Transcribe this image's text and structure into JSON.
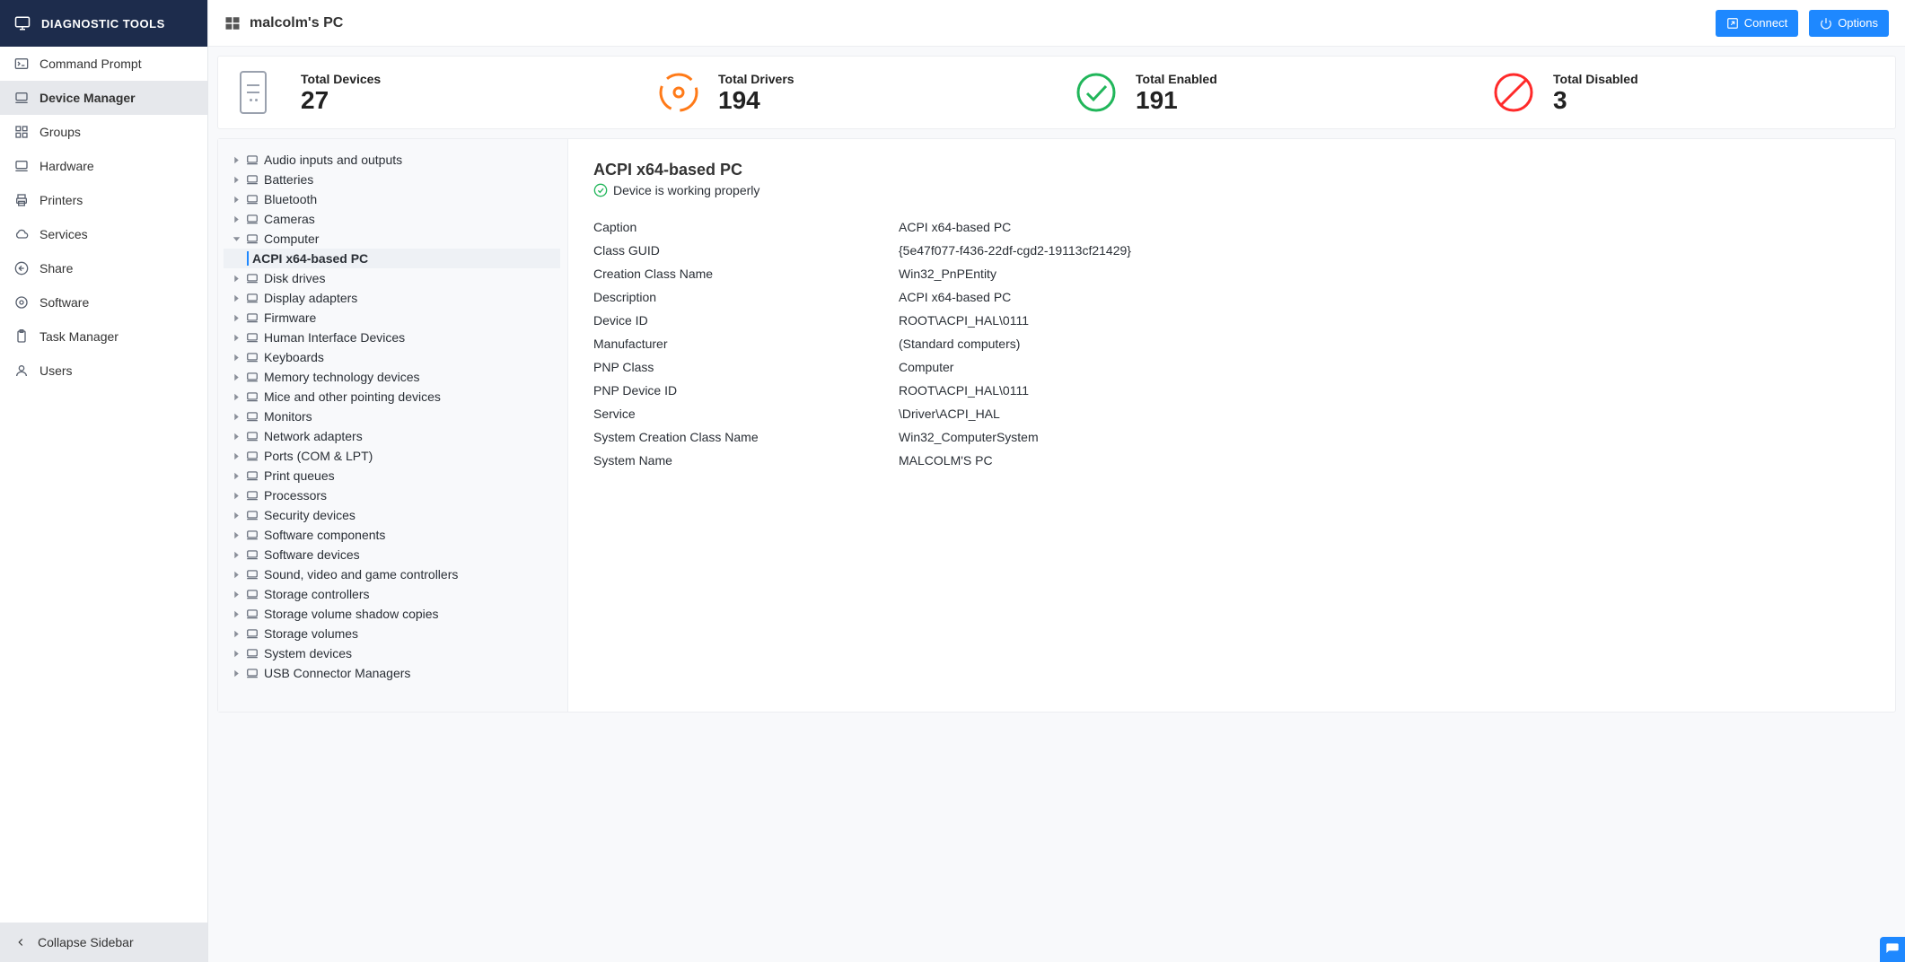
{
  "sidebar": {
    "header": "DIAGNOSTIC TOOLS",
    "items": [
      {
        "label": "Command Prompt",
        "icon": "terminal-icon"
      },
      {
        "label": "Device Manager",
        "icon": "laptop-icon"
      },
      {
        "label": "Groups",
        "icon": "grid-icon"
      },
      {
        "label": "Hardware",
        "icon": "laptop-icon"
      },
      {
        "label": "Printers",
        "icon": "printer-icon"
      },
      {
        "label": "Services",
        "icon": "cloud-icon"
      },
      {
        "label": "Share",
        "icon": "share-icon"
      },
      {
        "label": "Software",
        "icon": "target-icon"
      },
      {
        "label": "Task Manager",
        "icon": "clipboard-icon"
      },
      {
        "label": "Users",
        "icon": "user-icon"
      }
    ],
    "active_index": 1,
    "footer": "Collapse Sidebar"
  },
  "topbar": {
    "title": "malcolm's PC",
    "connect": "Connect",
    "options": "Options"
  },
  "summary": {
    "devices": {
      "label": "Total Devices",
      "value": "27"
    },
    "drivers": {
      "label": "Total Drivers",
      "value": "194"
    },
    "enabled": {
      "label": "Total Enabled",
      "value": "191"
    },
    "disabled": {
      "label": "Total Disabled",
      "value": "3"
    }
  },
  "tree": {
    "categories": [
      {
        "label": "Audio inputs and outputs"
      },
      {
        "label": "Batteries"
      },
      {
        "label": "Bluetooth"
      },
      {
        "label": "Cameras"
      },
      {
        "label": "Computer",
        "expanded": true,
        "children": [
          {
            "label": "ACPI x64-based PC",
            "selected": true
          }
        ]
      },
      {
        "label": "Disk drives"
      },
      {
        "label": "Display adapters"
      },
      {
        "label": "Firmware"
      },
      {
        "label": "Human Interface Devices"
      },
      {
        "label": "Keyboards"
      },
      {
        "label": "Memory technology devices"
      },
      {
        "label": "Mice and other pointing devices"
      },
      {
        "label": "Monitors"
      },
      {
        "label": "Network adapters"
      },
      {
        "label": "Ports (COM & LPT)"
      },
      {
        "label": "Print queues"
      },
      {
        "label": "Processors"
      },
      {
        "label": "Security devices"
      },
      {
        "label": "Software components"
      },
      {
        "label": "Software devices"
      },
      {
        "label": "Sound, video and game controllers"
      },
      {
        "label": "Storage controllers"
      },
      {
        "label": "Storage volume shadow copies"
      },
      {
        "label": "Storage volumes"
      },
      {
        "label": "System devices"
      },
      {
        "label": "USB Connector Managers"
      }
    ]
  },
  "details": {
    "title": "ACPI x64-based PC",
    "status": "Device is working properly",
    "props": [
      {
        "key": "Caption",
        "value": "ACPI x64-based PC"
      },
      {
        "key": "Class GUID",
        "value": "{5e47f077-f436-22df-cgd2-19113cf21429}"
      },
      {
        "key": "Creation Class Name",
        "value": "Win32_PnPEntity"
      },
      {
        "key": "Description",
        "value": "ACPI x64-based PC"
      },
      {
        "key": "Device ID",
        "value": "ROOT\\ACPI_HAL\\0111"
      },
      {
        "key": "Manufacturer",
        "value": "(Standard computers)"
      },
      {
        "key": "PNP Class",
        "value": "Computer"
      },
      {
        "key": "PNP Device ID",
        "value": "ROOT\\ACPI_HAL\\0111"
      },
      {
        "key": "Service",
        "value": "\\Driver\\ACPI_HAL"
      },
      {
        "key": "System Creation Class Name",
        "value": "Win32_ComputerSystem"
      },
      {
        "key": "System Name",
        "value": "MALCOLM'S PC"
      }
    ]
  }
}
